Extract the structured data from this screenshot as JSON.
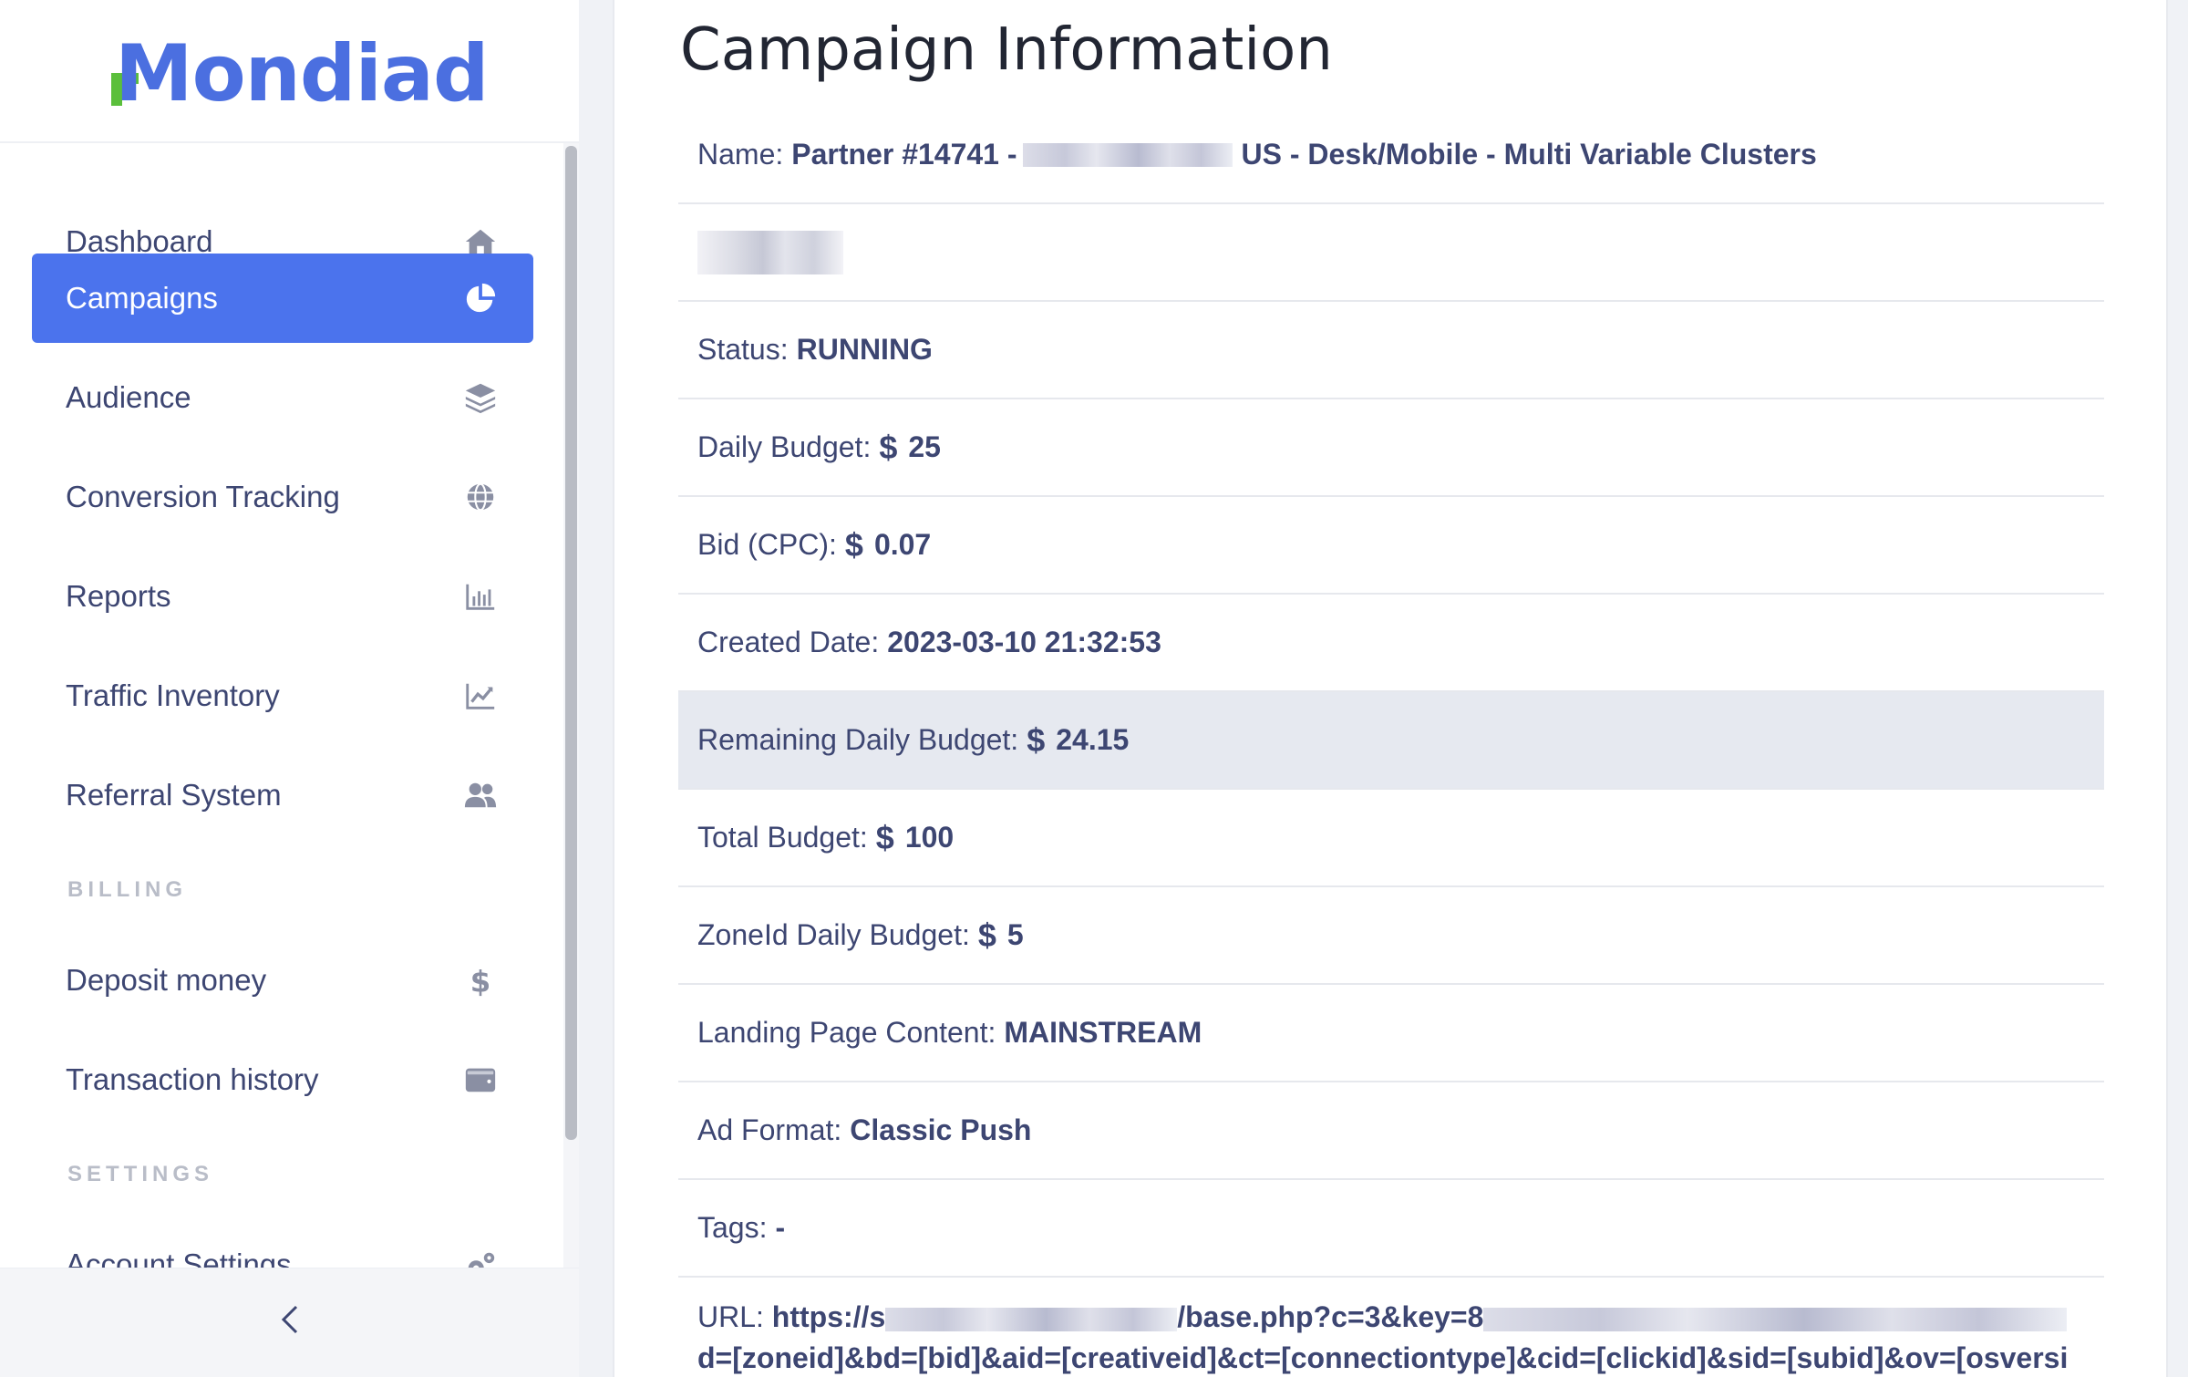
{
  "brand": {
    "name": "Mondiad",
    "primary_color": "#4b6fe0",
    "accent_color": "#5bbf3b"
  },
  "sidebar": {
    "items": [
      {
        "label": "Dashboard",
        "icon": "home-icon",
        "active": false
      },
      {
        "label": "Campaigns",
        "icon": "pie-chart-icon",
        "active": true
      },
      {
        "label": "Audience",
        "icon": "layers-icon",
        "active": false
      },
      {
        "label": "Conversion Tracking",
        "icon": "globe-icon",
        "active": false
      },
      {
        "label": "Reports",
        "icon": "bar-chart-icon",
        "active": false
      },
      {
        "label": "Traffic Inventory",
        "icon": "line-chart-icon",
        "active": false
      },
      {
        "label": "Referral System",
        "icon": "users-icon",
        "active": false
      }
    ],
    "billing_label": "BILLING",
    "billing_items": [
      {
        "label": "Deposit money",
        "icon": "dollar-icon"
      },
      {
        "label": "Transaction history",
        "icon": "wallet-icon"
      }
    ],
    "settings_label": "SETTINGS",
    "settings_items": [
      {
        "label": "Account Settings",
        "icon": "gears-icon"
      }
    ],
    "collapse_icon": "chevron-left-icon"
  },
  "main": {
    "title": "Campaign Information",
    "name_label": "Name:",
    "name_value_prefix": "Partner #14741 -",
    "name_value_suffix": "US - Desk/Mobile - Multi Variable Clusters",
    "status_label": "Status:",
    "status_value": "RUNNING",
    "daily_budget_label": "Daily Budget:",
    "daily_budget_currency": "$",
    "daily_budget_value": "25",
    "bid_label": "Bid (CPC):",
    "bid_currency": "$",
    "bid_value": "0.07",
    "created_label": "Created Date:",
    "created_value": "2023-03-10 21:32:53",
    "remaining_label": "Remaining Daily Budget:",
    "remaining_currency": "$",
    "remaining_value": "24.15",
    "total_label": "Total Budget:",
    "total_currency": "$",
    "total_value": "100",
    "zone_label": "ZoneId Daily Budget:",
    "zone_currency": "$",
    "zone_value": "5",
    "landing_label": "Landing Page Content:",
    "landing_value": "MAINSTREAM",
    "adformat_label": "Ad Format:",
    "adformat_value": "Classic Push",
    "tags_label": "Tags:",
    "tags_value": "-",
    "url_label": "URL:",
    "url_part1": "https://s",
    "url_part2": "/base.php?c=3&key=8",
    "url_line2": "d=[zoneid]&bd=[bid]&aid=[creativeid]&ct=[connectiontype]&cid=[clickid]&sid=[subid]&ov=[osversi"
  }
}
